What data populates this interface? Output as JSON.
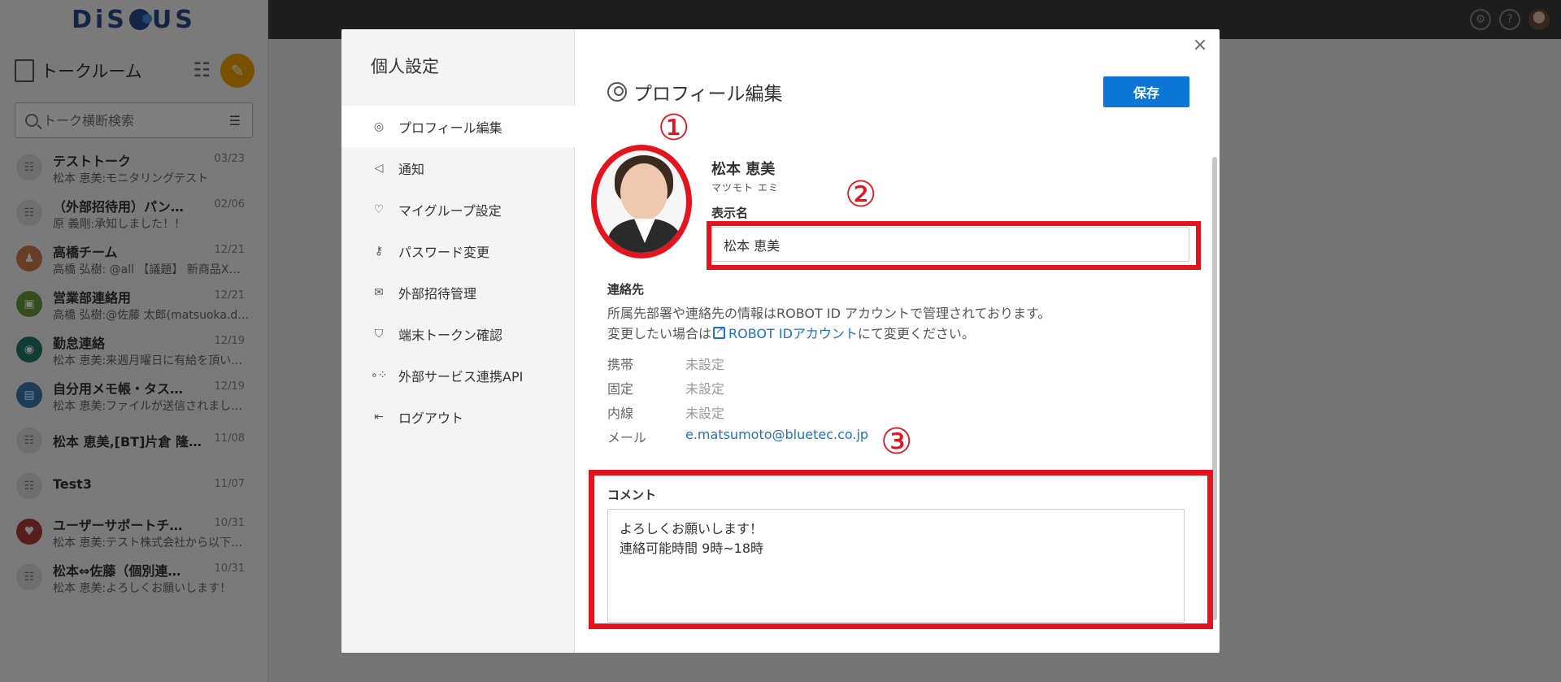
{
  "app": {
    "logo": "DiSCUS"
  },
  "sidebar": {
    "title": "トークルーム",
    "search_placeholder": "トーク横断検索",
    "talks": [
      {
        "name": "テストトーク",
        "date": "03/23",
        "message": "松本 恵美:モニタリングテスト"
      },
      {
        "name": "（外部招待用）パン…",
        "date": "02/06",
        "message": "原 義剛:承知しました！！"
      },
      {
        "name": "高橋チーム",
        "date": "12/21",
        "message": "高橋 弘樹: @all 【議題】 新商品X…"
      },
      {
        "name": "営業部連絡用",
        "date": "12/21",
        "message": "高橋 弘樹:@佐藤 太郎(matsuoka.d…"
      },
      {
        "name": "勤怠連絡",
        "date": "12/19",
        "message": "松本 恵美:来週月曜日に有給を頂い…"
      },
      {
        "name": "自分用メモ帳・タス…",
        "date": "12/19",
        "message": "松本 恵美:ファイルが送信されまし…"
      },
      {
        "name": "松本 恵美,[BT]片倉 隆…",
        "date": "11/08",
        "message": ""
      },
      {
        "name": "Test3",
        "date": "11/07",
        "message": ""
      },
      {
        "name": "ユーザーサポートチ…",
        "date": "10/31",
        "message": "松本 恵美:テスト株式会社から以下…"
      },
      {
        "name": "松本⇔佐藤（個別連…",
        "date": "10/31",
        "message": "松本 恵美:よろしくお願いします！"
      }
    ]
  },
  "modal": {
    "nav_title": "個人設定",
    "nav_items": [
      {
        "label": "プロフィール編集",
        "icon": "user-circle-icon"
      },
      {
        "label": "通知",
        "icon": "megaphone-icon"
      },
      {
        "label": "マイグループ設定",
        "icon": "user-heart-icon"
      },
      {
        "label": "パスワード変更",
        "icon": "key-icon"
      },
      {
        "label": "外部招待管理",
        "icon": "user-mail-icon"
      },
      {
        "label": "端末トークン確認",
        "icon": "shield-icon"
      },
      {
        "label": "外部サービス連携API",
        "icon": "api-icon"
      },
      {
        "label": "ログアウト",
        "icon": "logout-icon"
      }
    ],
    "page_title": "プロフィール編集",
    "save_label": "保存",
    "close_symbol": "×"
  },
  "profile": {
    "name": "松本 恵美",
    "kana": "マツモト エミ",
    "display_name_label": "表示名",
    "display_name_value": "松本 恵美",
    "contact_title": "連絡先",
    "contact_desc1": "所属先部署や連絡先の情報はROBOT ID アカウントで管理されております。",
    "contact_desc2_prefix": "変更したい場合は",
    "contact_link": "ROBOT IDアカウント",
    "contact_desc2_suffix": "にて変更ください。",
    "rows": [
      {
        "label": "携帯",
        "value": "未設定"
      },
      {
        "label": "固定",
        "value": "未設定"
      },
      {
        "label": "内線",
        "value": "未設定"
      },
      {
        "label": "メール",
        "value": "e.matsumoto@bluetec.co.jp"
      }
    ],
    "comment_label": "コメント",
    "comment_value": "よろしくお願いします！\n連絡可能時間 9時~18時"
  },
  "annotations": {
    "m1": "①",
    "m2": "②",
    "m3": "③",
    "color": "#e3141e"
  }
}
